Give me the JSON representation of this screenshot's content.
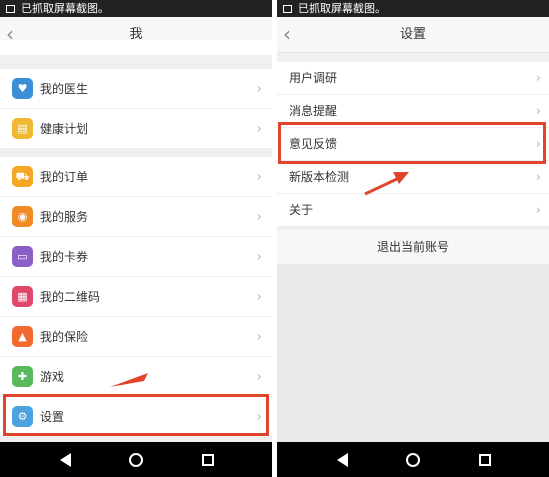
{
  "left_screen": {
    "status_text": "已抓取屏幕截图。",
    "title": "我",
    "items": [
      {
        "label": "我的医生",
        "icon": "doctor-icon",
        "color": "#3b8fd8"
      },
      {
        "label": "健康计划",
        "icon": "health-plan-icon",
        "color": "#f0b830"
      },
      {
        "label": "我的订单",
        "icon": "cart-icon",
        "color": "#f5a623"
      },
      {
        "label": "我的服务",
        "icon": "service-icon",
        "color": "#f08a24"
      },
      {
        "label": "我的卡券",
        "icon": "coupon-icon",
        "color": "#8a5fc6"
      },
      {
        "label": "我的二维码",
        "icon": "qrcode-icon",
        "color": "#e0476b"
      },
      {
        "label": "我的保险",
        "icon": "insurance-icon",
        "color": "#f26a2e"
      },
      {
        "label": "游戏",
        "icon": "game-icon",
        "color": "#5cb85c"
      },
      {
        "label": "设置",
        "icon": "gear-icon",
        "color": "#4aa3df"
      }
    ]
  },
  "right_screen": {
    "status_text": "已抓取屏幕截图。",
    "title": "设置",
    "items": [
      {
        "label": "用户调研"
      },
      {
        "label": "消息提醒"
      },
      {
        "label": "意见反馈"
      },
      {
        "label": "新版本检测"
      },
      {
        "label": "关于"
      }
    ],
    "logout_label": "退出当前账号"
  },
  "colors": {
    "highlight": "#e0452b",
    "arrow": "#e0452b"
  }
}
